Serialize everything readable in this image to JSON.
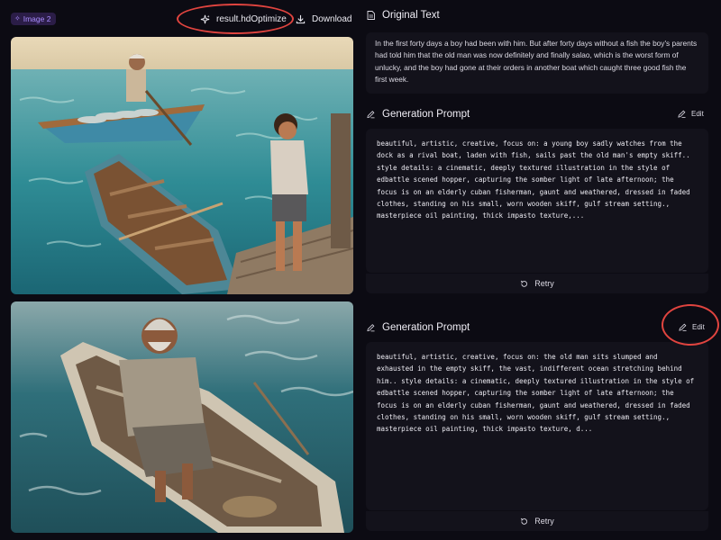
{
  "header": {
    "badge_label": "Image 2",
    "optimize_label": "result.hdOptimize",
    "download_label": "Download"
  },
  "original": {
    "title": "Original Text",
    "text": "In the first forty days a boy had been with him. But after forty days without a fish the boy's parents had told him that the old man was now definitely and finally salao, which is the worst form of unlucky, and the boy had gone at their orders in another boat which caught three good fish the first week."
  },
  "prompts": [
    {
      "title": "Generation Prompt",
      "edit_label": "Edit",
      "text": "beautiful, artistic, creative, focus on: a young boy sadly watches from the dock as a rival boat, laden with fish, sails past the old man's empty skiff.. style details: a cinematic, deeply textured illustration in the style of edbattle scened hopper, capturing the somber light of late afternoon; the focus is on an elderly cuban fisherman, gaunt and weathered, dressed in faded clothes, standing on his small, worn wooden skiff, gulf stream setting., masterpiece oil painting, thick impasto texture,...",
      "retry_label": "Retry"
    },
    {
      "title": "Generation Prompt",
      "edit_label": "Edit",
      "text": "beautiful, artistic, creative, focus on: the old man sits slumped and exhausted in the empty skiff, the vast, indifferent ocean stretching behind him.. style details: a cinematic, deeply textured illustration in the style of edbattle scened hopper, capturing the somber light of late afternoon; the focus is on an elderly cuban fisherman, gaunt and weathered, dressed in faded clothes, standing on his small, worn wooden skiff, gulf stream setting., masterpiece oil painting, thick impasto texture, d...",
      "retry_label": "Retry"
    }
  ],
  "colors": {
    "background": "#0c0b13",
    "panel": "#13121b",
    "badge_accent": "#a98cff",
    "annotation_red": "#e0443f"
  }
}
